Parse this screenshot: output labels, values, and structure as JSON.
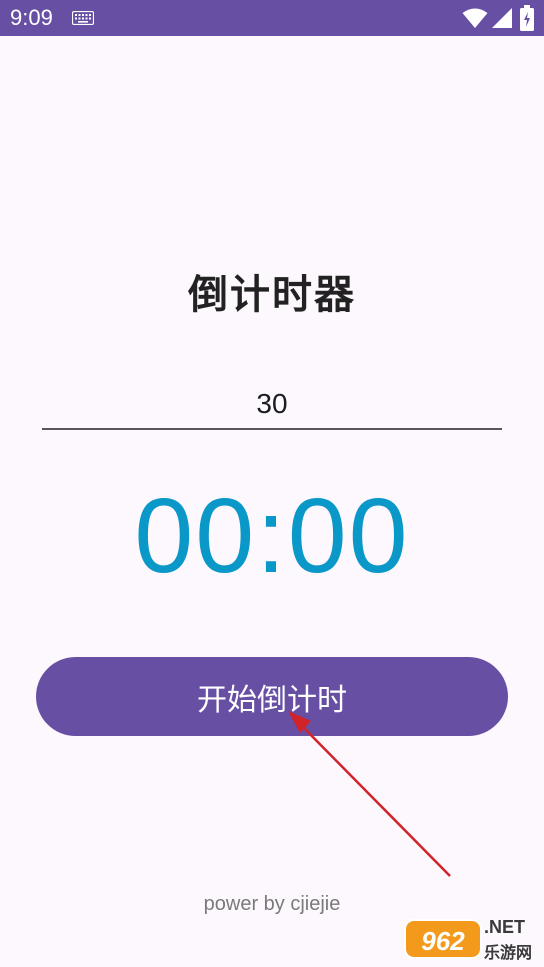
{
  "status_bar": {
    "time": "9:09",
    "icons": [
      "keyboard-icon",
      "wifi-icon",
      "signal-icon",
      "battery-icon"
    ],
    "background": "#6750a4"
  },
  "app": {
    "title": "倒计时器",
    "seconds_input_value": "30",
    "timer_display": "00:00",
    "start_button_label": "开始倒计时",
    "footer_text": "power by cjiejie"
  },
  "watermark": {
    "badge": "962",
    "net": ".NET",
    "cn": "乐游网"
  },
  "colors": {
    "primary": "#6750a4",
    "timer": "#0a98c8",
    "annotation_arrow": "#d0232a",
    "background": "#fdf8fd"
  }
}
